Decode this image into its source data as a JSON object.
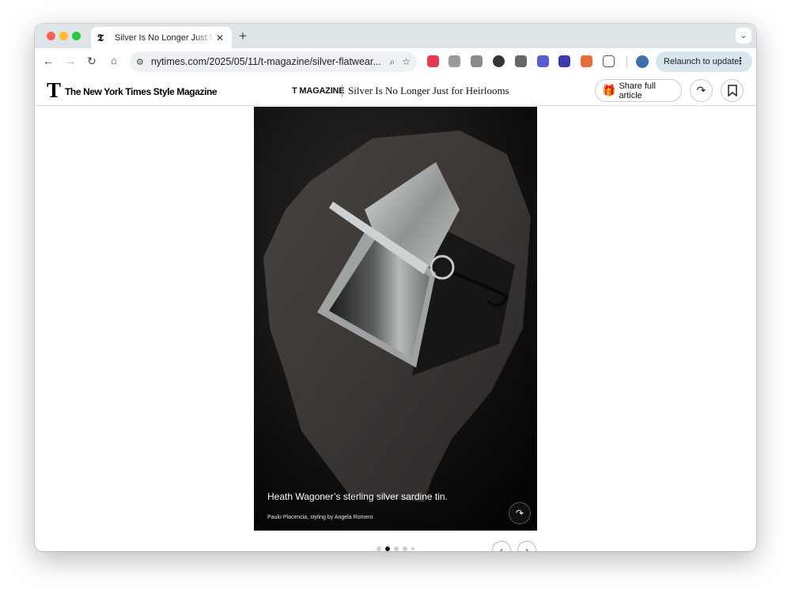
{
  "browser": {
    "tab_title": "Silver Is No Longer Just for Heirlooms",
    "tab_favicon": "𝕿",
    "tab_close": "✕",
    "new_tab": "+",
    "url": "nytimes.com/2025/05/11/t-magazine/silver-flatwear...",
    "relaunch_label": "Relaunch to update",
    "icons": {
      "back": "←",
      "forward": "→",
      "reload": "↻",
      "home": "⌂",
      "tune": "⚙",
      "zoom": "⌕",
      "star": "☆",
      "menu": "⋮",
      "tab_search": "⌄"
    }
  },
  "page": {
    "t_logo": "T",
    "brand": "The New York Times Style Magazine",
    "section": "T MAGAZINE",
    "headline": "Silver Is No Longer Just for Heirlooms",
    "share_full_label": "Share full article",
    "gift_icon": "🎁",
    "share_icon": "↷",
    "bookmark_icon": "🔖"
  },
  "slideshow": {
    "caption": "Heath Wagoner’s sterling silver sardine tin.",
    "credit": "Paulo Placencia, styling by Angela Romero",
    "share_icon": "↷",
    "prev_icon": "‹",
    "next_icon": "›",
    "current_slide": 2,
    "dot_count": 5
  },
  "colors": {
    "tab_strip": "#dee5e8",
    "relaunch_bg": "#d7e6ec",
    "profile": "#3d6fa8"
  }
}
